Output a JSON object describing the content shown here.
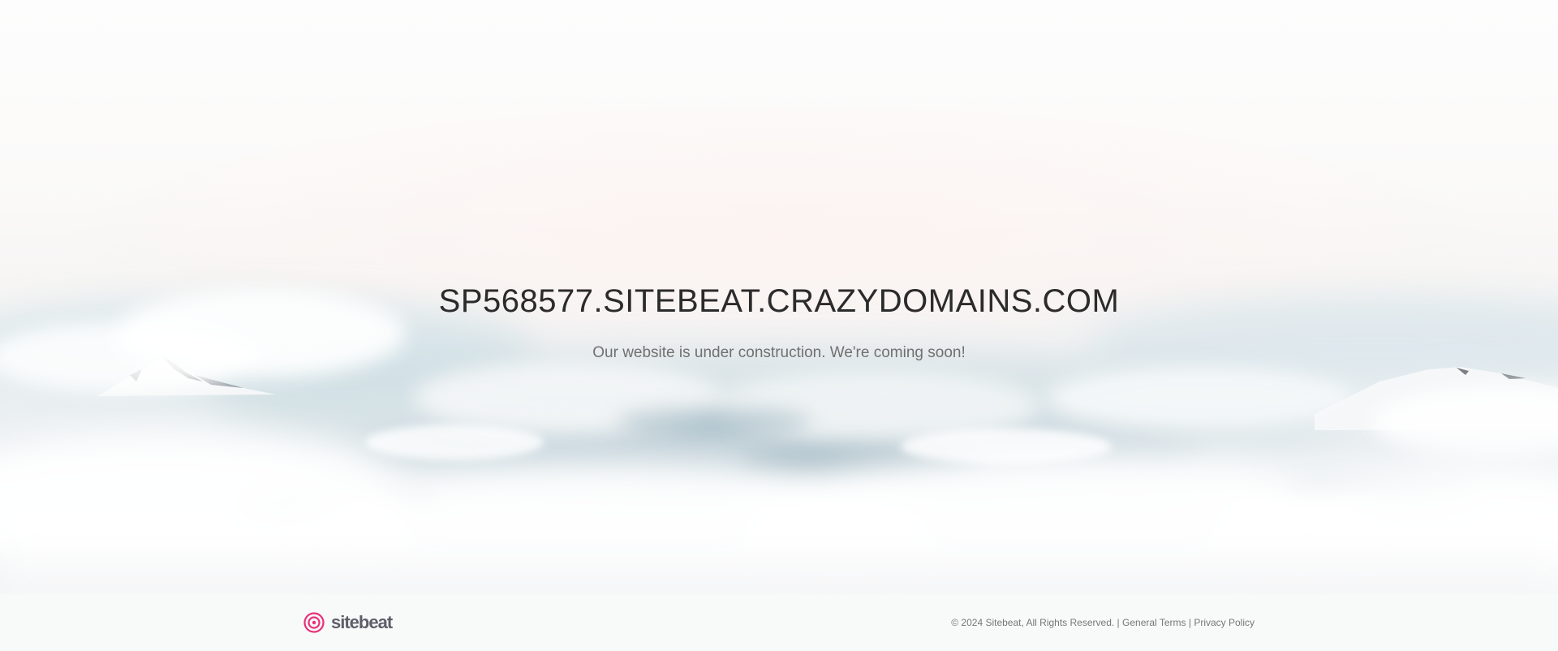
{
  "hero": {
    "title": "SP568577.SITEBEAT.CRAZYDOMAINS.COM",
    "subtitle": "Our website is under construction. We're coming soon!"
  },
  "footer": {
    "brand_name": "sitebeat",
    "brand_icon": "target-icon",
    "brand_color": "#e8317a",
    "copyright": "© 2024 Sitebeat, All Rights Reserved.",
    "separator": "|",
    "links": {
      "general_terms": "General Terms",
      "privacy_policy": "Privacy Policy"
    }
  }
}
